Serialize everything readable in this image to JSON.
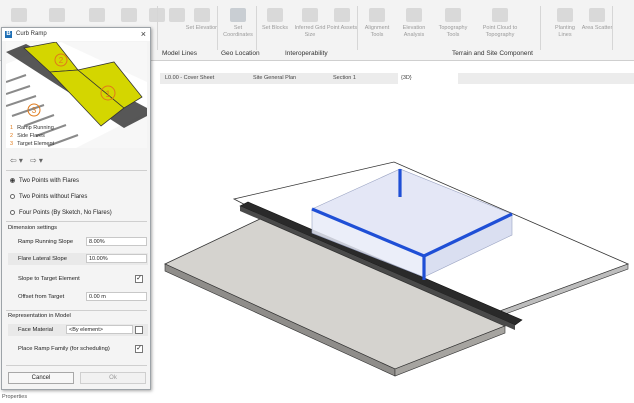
{
  "ribbon": {
    "tools": [
      "Set Elevation",
      "Set Coordinates",
      "Set Blocks",
      "Inferred Grid Size",
      "Point Assets",
      "Alignment Tools",
      "Elevation Analysis",
      "Topography Tools",
      "Point Cloud to Topography",
      "Planting Lines",
      "Area Scatter"
    ],
    "groups": {
      "model_lines": "Model Lines",
      "geo_location": "Geo Location",
      "interoperability": "Interoperability",
      "terrain": "Terrain and Site Component"
    }
  },
  "tabs": [
    {
      "label": "L0.00 - Cover Sheet"
    },
    {
      "label": "Site General Plan"
    },
    {
      "label": "Section 1"
    },
    {
      "label": "{3D}"
    }
  ],
  "dialog": {
    "title": "Curb Ramp",
    "close": "×",
    "diagram_numbers": [
      "1",
      "2",
      "3"
    ],
    "legend": [
      {
        "num": "1",
        "label": "Ramp Running"
      },
      {
        "num": "2",
        "label": "Side Flares"
      },
      {
        "num": "3",
        "label": "Target Element"
      }
    ],
    "nav": {
      "back": "⇦ ▾",
      "forward": "⇨ ▾"
    },
    "options": [
      {
        "label": "Two Points with Flares",
        "selected": true
      },
      {
        "label": "Two Points without Flares",
        "selected": false
      },
      {
        "label": "Four Points (By Sketch, No Flares)",
        "selected": false
      }
    ],
    "dimension_header": "Dimension settings",
    "ramp_running_slope": {
      "label": "Ramp Running Slope",
      "value": "8.00%"
    },
    "flare_lateral_slope": {
      "label": "Flare Lateral Slope",
      "value": "10.00%"
    },
    "slope_to_target": {
      "label": "Slope to Target Element",
      "check": "✓"
    },
    "offset": {
      "label": "Offset from Target",
      "value": "0.00 m"
    },
    "representation_header": "Representation in Model",
    "face_material": {
      "label": "Face Material",
      "value": "<By element>"
    },
    "place_family": {
      "label": "Place Ramp Family (for scheduling)",
      "check": "✓"
    },
    "cancel": "Cancel",
    "ok": "Ok"
  },
  "status": "Properties",
  "colors": {
    "ramp_yellow": "#d4d600",
    "number_orange": "#e07a1a",
    "edge_blue": "#1f4fd6"
  }
}
